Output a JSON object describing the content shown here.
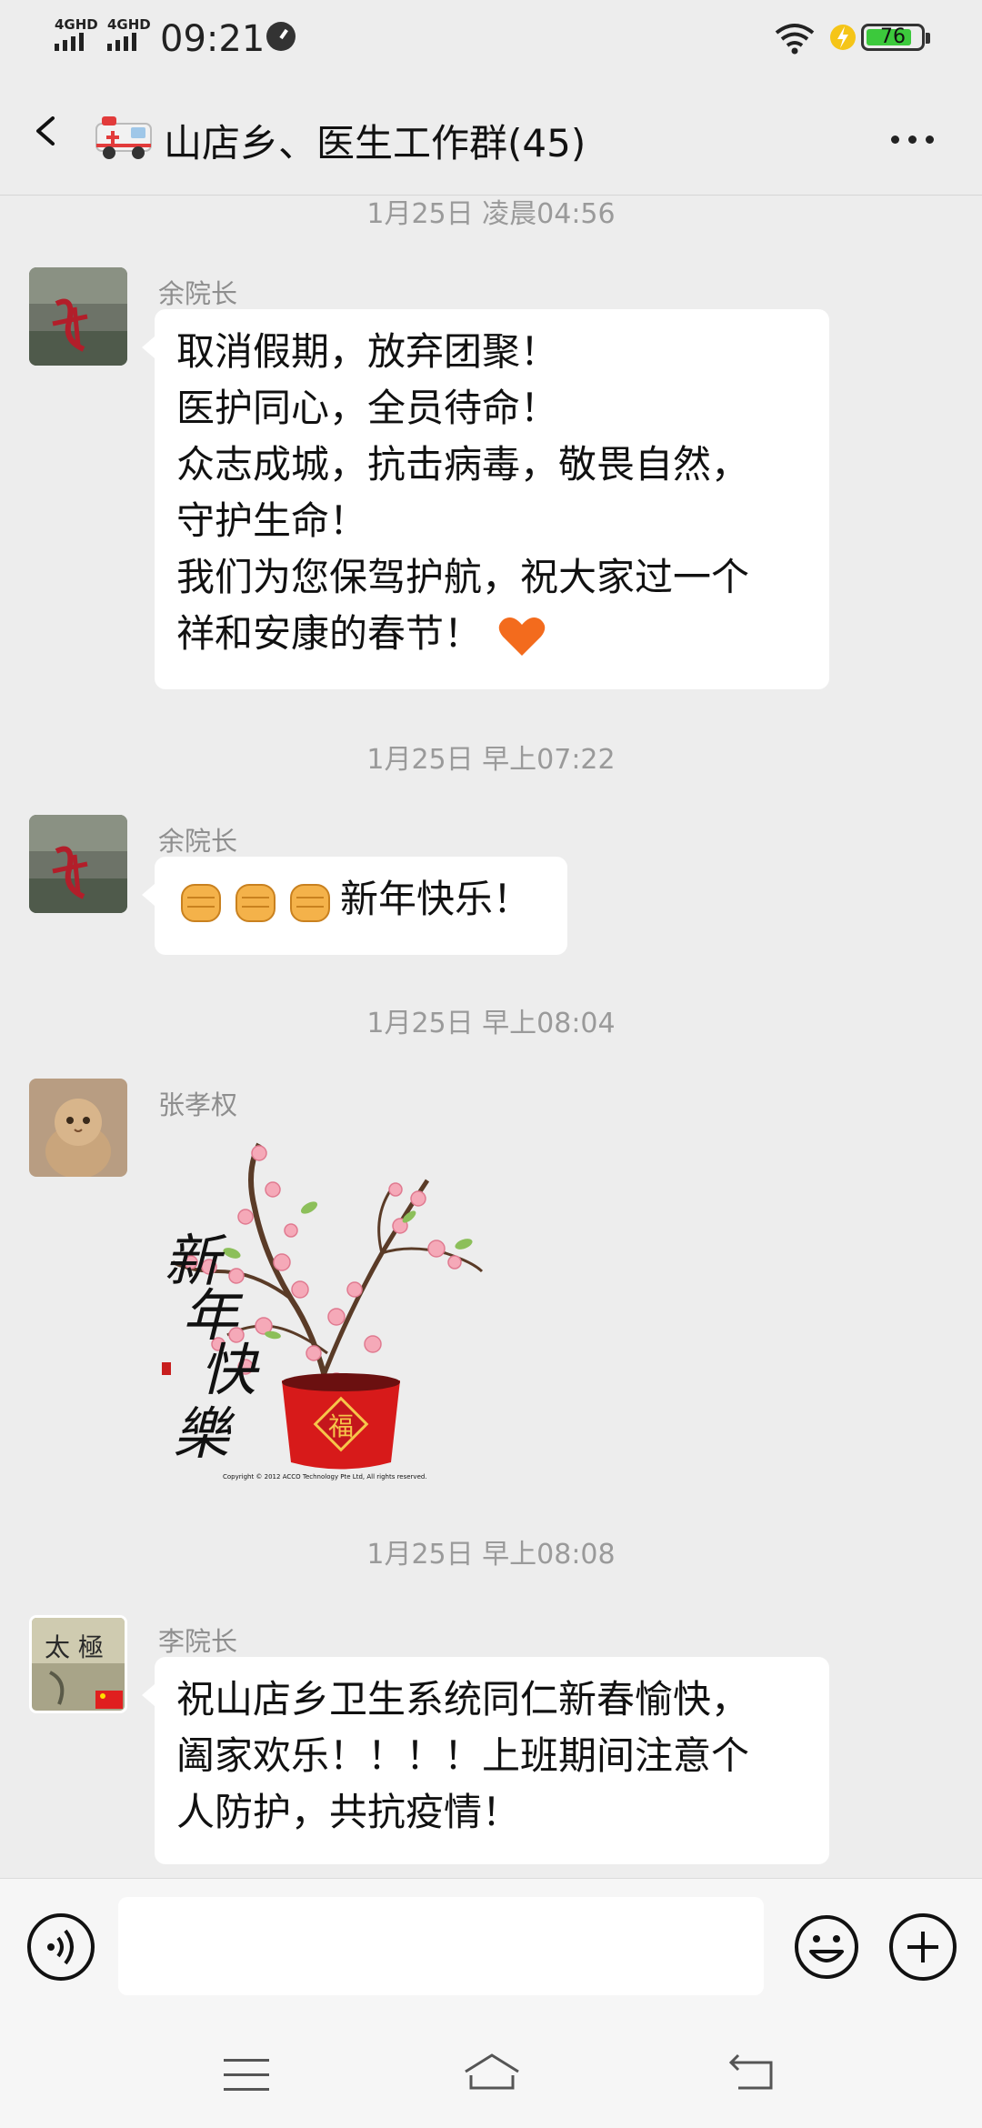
{
  "status_bar": {
    "sim1": "4GHD",
    "sim2": "4GHD",
    "time": "09:21",
    "battery": "76"
  },
  "header": {
    "title": "山店乡、医生工作群(45)"
  },
  "messages": [
    {
      "timestamp": "1月25日 凌晨04:56",
      "sender": "余院长",
      "lines": [
        "取消假期，放弃团聚！",
        "医护同心，全员待命！",
        "众志成城，抗击病毒，敬畏自然，",
        "守护生命！",
        "我们为您保驾护航，祝大家过一个",
        "祥和安康的春节！"
      ],
      "trailing_icon": "heart-emoji"
    },
    {
      "timestamp": "1月25日 早上07:22",
      "sender": "余院长",
      "text": "新年快乐！",
      "leading_icons": [
        "fist-emoji",
        "fist-emoji",
        "fist-emoji"
      ]
    },
    {
      "timestamp": "1月25日 早上08:04",
      "sender": "张孝权",
      "sticker": {
        "calligraphy": [
          "新",
          "年",
          "快",
          "樂"
        ],
        "pot_char": "福",
        "copyright": "Copyright © 2012 ACCO Technology Pte Ltd, All rights reserved."
      }
    },
    {
      "timestamp": "1月25日 早上08:08",
      "sender": "李院长",
      "lines": [
        "祝山店乡卫生系统同仁新春愉快，",
        "阖家欢乐！！！！上班期间注意个",
        "人防护，共抗疫情！"
      ]
    }
  ],
  "colors": {
    "background": "#ededed",
    "bubble": "#ffffff",
    "timestamp": "#9a9a9a",
    "battery_fill": "#3cc93c"
  }
}
